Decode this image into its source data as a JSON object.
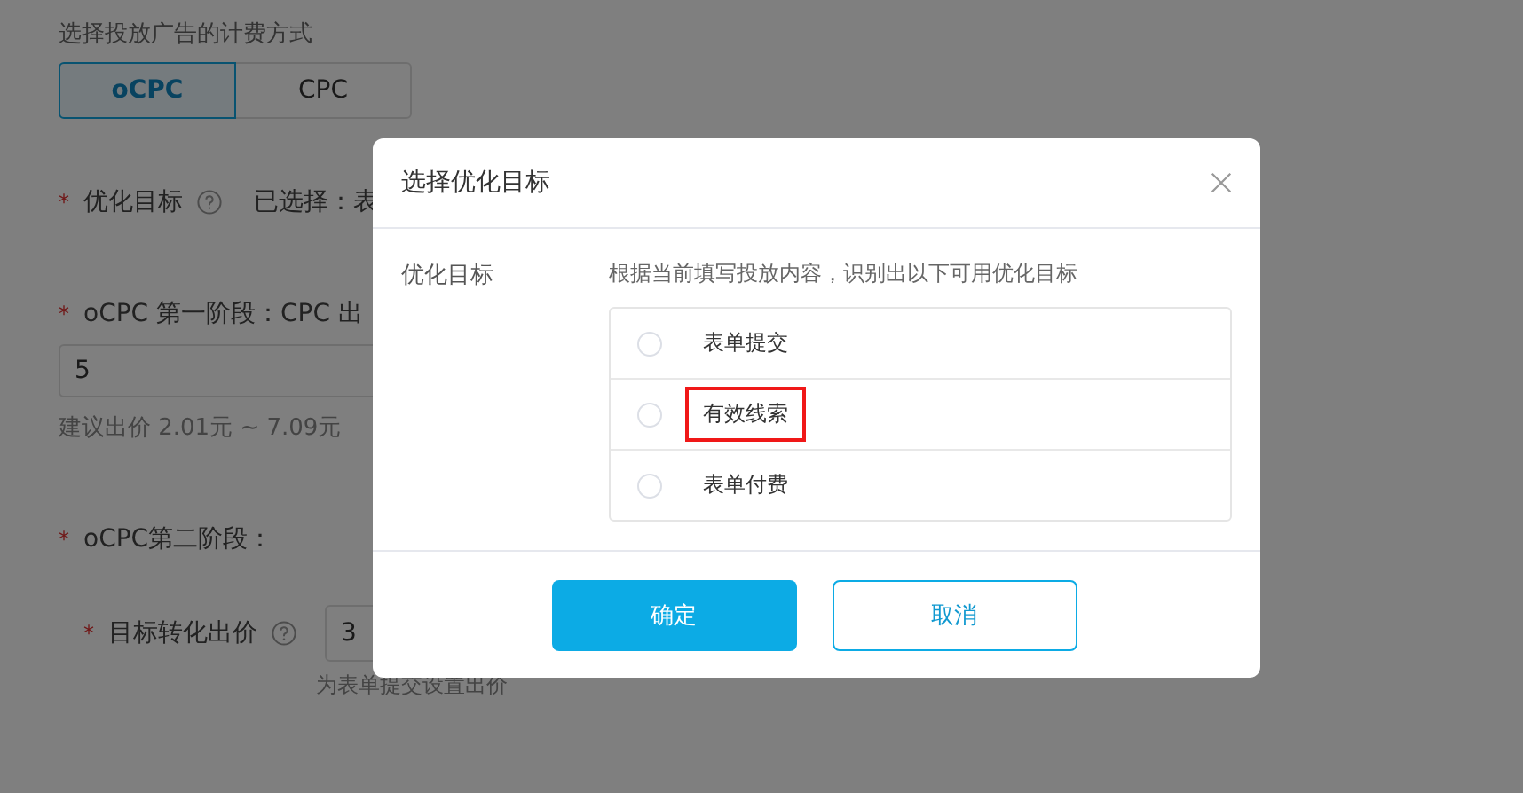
{
  "page": {
    "billing_title": "选择投放广告的计费方式",
    "billing_modes": [
      {
        "label": "oCPC",
        "selected": true
      },
      {
        "label": "CPC",
        "selected": false
      }
    ],
    "goal_mark": "*",
    "goal_label": "优化目标",
    "goal_selected": "已选择：表",
    "stage1_mark": "*",
    "stage1_label": "oCPC 第一阶段：CPC 出",
    "stage1_value": "5",
    "stage1_hint": "建议出价 2.01元 ~ 7.09元",
    "stage2_mark": "*",
    "stage2_label": "oCPC第二阶段：",
    "target_mark": "*",
    "target_label": "目标转化出价",
    "target_value": "3",
    "target_hint": "为表单提交设置出价"
  },
  "dialog": {
    "title": "选择优化目标",
    "field_label": "优化目标",
    "description": "根据当前填写投放内容，识别出以下可用优化目标",
    "options": [
      {
        "label": "表单提交",
        "selected": false,
        "highlighted": false
      },
      {
        "label": "有效线索",
        "selected": false,
        "highlighted": true
      },
      {
        "label": "表单付费",
        "selected": false,
        "highlighted": false
      }
    ],
    "confirm": "确定",
    "cancel": "取消"
  }
}
